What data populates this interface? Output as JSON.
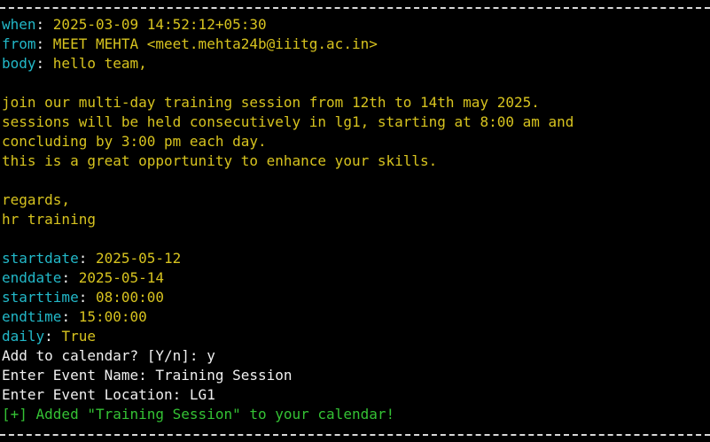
{
  "colors": {
    "background": "#000000",
    "key": "#22b8c8",
    "value": "#d7c31f",
    "text": "#f0f0f0",
    "success": "#34c234",
    "rule": "#d8d8d8"
  },
  "email": {
    "when_key": "when",
    "when_value": "2025-03-09 14:52:12+05:30",
    "from_key": "from",
    "from_value": "MEET MEHTA <meet.mehta24b@iiitg.ac.in>",
    "body_key": "body",
    "body_lines": [
      "hello team,",
      "",
      "join our multi-day training session from 12th to 14th may 2025.",
      "sessions will be held consecutively in lg1, starting at 8:00 am and",
      "concluding by 3:00 pm each day.",
      "this is a great opportunity to enhance your skills.",
      "",
      "regards,",
      "hr training"
    ]
  },
  "parsed": [
    {
      "key": "startdate",
      "value": "2025-05-12"
    },
    {
      "key": "enddate",
      "value": "2025-05-14"
    },
    {
      "key": "starttime",
      "value": "08:00:00"
    },
    {
      "key": "endtime",
      "value": "15:00:00"
    },
    {
      "key": "daily",
      "value": "True"
    }
  ],
  "prompts": {
    "add_prompt": "Add to calendar? [Y/n]: ",
    "add_answer": "y",
    "name_prompt": "Enter Event Name: ",
    "name_answer": "Training Session",
    "location_prompt": "Enter Event Location: ",
    "location_answer": "LG1"
  },
  "result": "[+] Added \"Training Session\" to your calendar!"
}
